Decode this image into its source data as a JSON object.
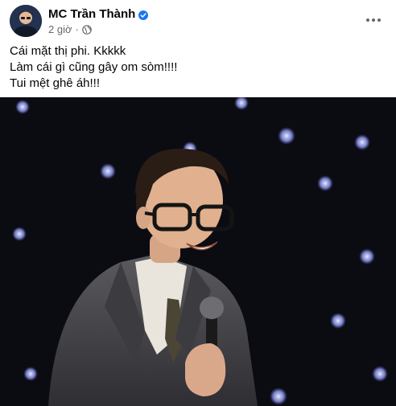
{
  "post": {
    "author": "MC Trần Thành",
    "time": "2 giờ",
    "separator": "·",
    "lines": [
      "Cái mặt thị phi. Kkkkk",
      "Làm cái gì cũng gây om sòm!!!!",
      "Tui mệt ghê áh!!!"
    ],
    "icons": {
      "verified": "verified-badge-icon",
      "privacy": "globe-icon",
      "more": "more-options-icon"
    },
    "colors": {
      "text": "#050505",
      "secondary": "#65676b",
      "verified": "#1877f2",
      "photo_background": "#0b0b12"
    }
  }
}
